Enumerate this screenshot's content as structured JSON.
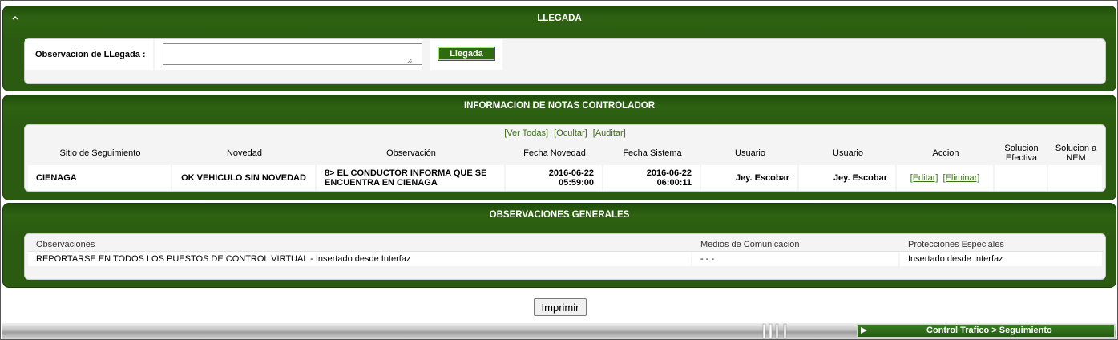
{
  "llegada": {
    "title": "LLEGADA",
    "label": "Observacion de LLegada :",
    "input_value": "",
    "button_label": "Llegada"
  },
  "notas": {
    "title": "INFORMACION DE NOTAS CONTROLADOR",
    "links": [
      "[Ver Todas]",
      "[Ocultar]",
      "[Auditar]"
    ],
    "columns": [
      "Sitio de Seguimiento",
      "Novedad",
      "Observación",
      "Fecha Novedad",
      "Fecha Sistema",
      "Usuario",
      "Usuario",
      "Accion",
      "Solucion Efectiva",
      "Solucion a NEM"
    ],
    "rows": [
      {
        "sitio": "CIENAGA",
        "novedad": "OK VEHICULO SIN NOVEDAD",
        "observacion": "8> EL CONDUCTOR INFORMA QUE SE ENCUENTRA EN CIENAGA",
        "fecha_novedad_date": "2016-06-22",
        "fecha_novedad_time": "05:59:00",
        "fecha_sistema_date": "2016-06-22",
        "fecha_sistema_time": "06:00:11",
        "usuario1": "Jey. Escobar",
        "usuario2": "Jey. Escobar",
        "accion_editar": "[Editar]",
        "accion_eliminar": "[Eliminar]",
        "solucion_efectiva": "",
        "solucion_nem": ""
      }
    ]
  },
  "observaciones": {
    "title": "OBSERVACIONES GENERALES",
    "columns": [
      "Observaciones",
      "Medios de Comunicacion",
      "Protecciones Especiales"
    ],
    "rows": [
      {
        "observaciones": "REPORTARSE EN TODOS LOS PUESTOS DE CONTROL VIRTUAL - Insertado desde Interfaz",
        "medios": "- - -",
        "protecciones": "Insertado desde Interfaz"
      }
    ]
  },
  "print_label": "Imprimir",
  "breadcrumb": "Control Trafico > Seguimiento",
  "icons": {
    "collapse": "chevron-up-icon",
    "breadcrumb_arrow": "play-arrow-icon"
  },
  "colors": {
    "panel_green": "#2b5b10",
    "link_green": "#3c6e18",
    "button_green": "#2d6b0f"
  }
}
